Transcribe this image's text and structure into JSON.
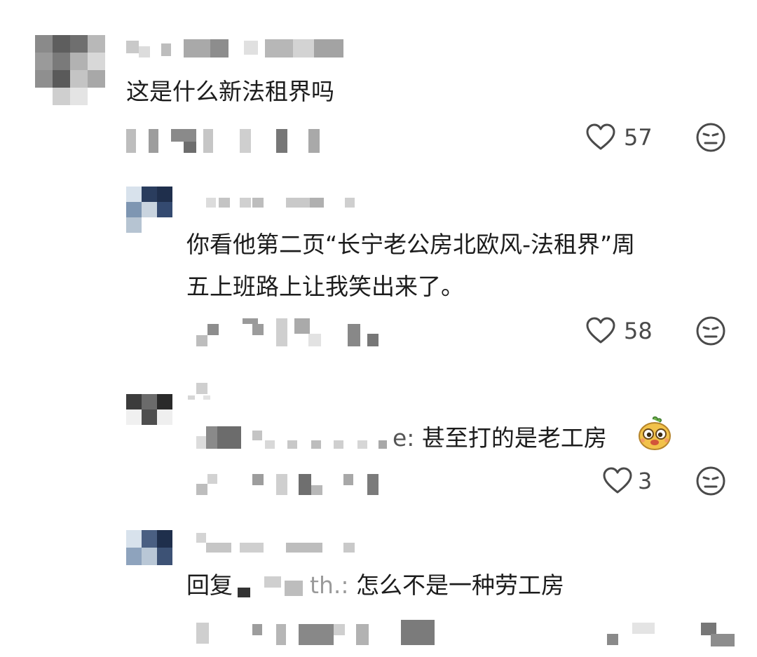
{
  "comments": [
    {
      "text": "这是什么新法租界吗",
      "likes": "57"
    },
    {
      "line1": "你看他第二页“长宁老公房北欧风-法租界”周",
      "line2": "五上班路上让我笑出来了。",
      "likes": "58"
    },
    {
      "reply_suffix": "e:",
      "text": "甚至打的是老工房",
      "likes": "3"
    },
    {
      "reply_prefix": "回复",
      "reply_suffix": "th.:",
      "text": "怎么不是一种劳工房"
    }
  ],
  "icons": {
    "like": "heart-outline-icon",
    "dislike": "neutral-face-icon",
    "sticker": "cartoon-sticker"
  },
  "colors": {
    "text": "#1c1c1c",
    "muted": "#4a4a4a"
  }
}
